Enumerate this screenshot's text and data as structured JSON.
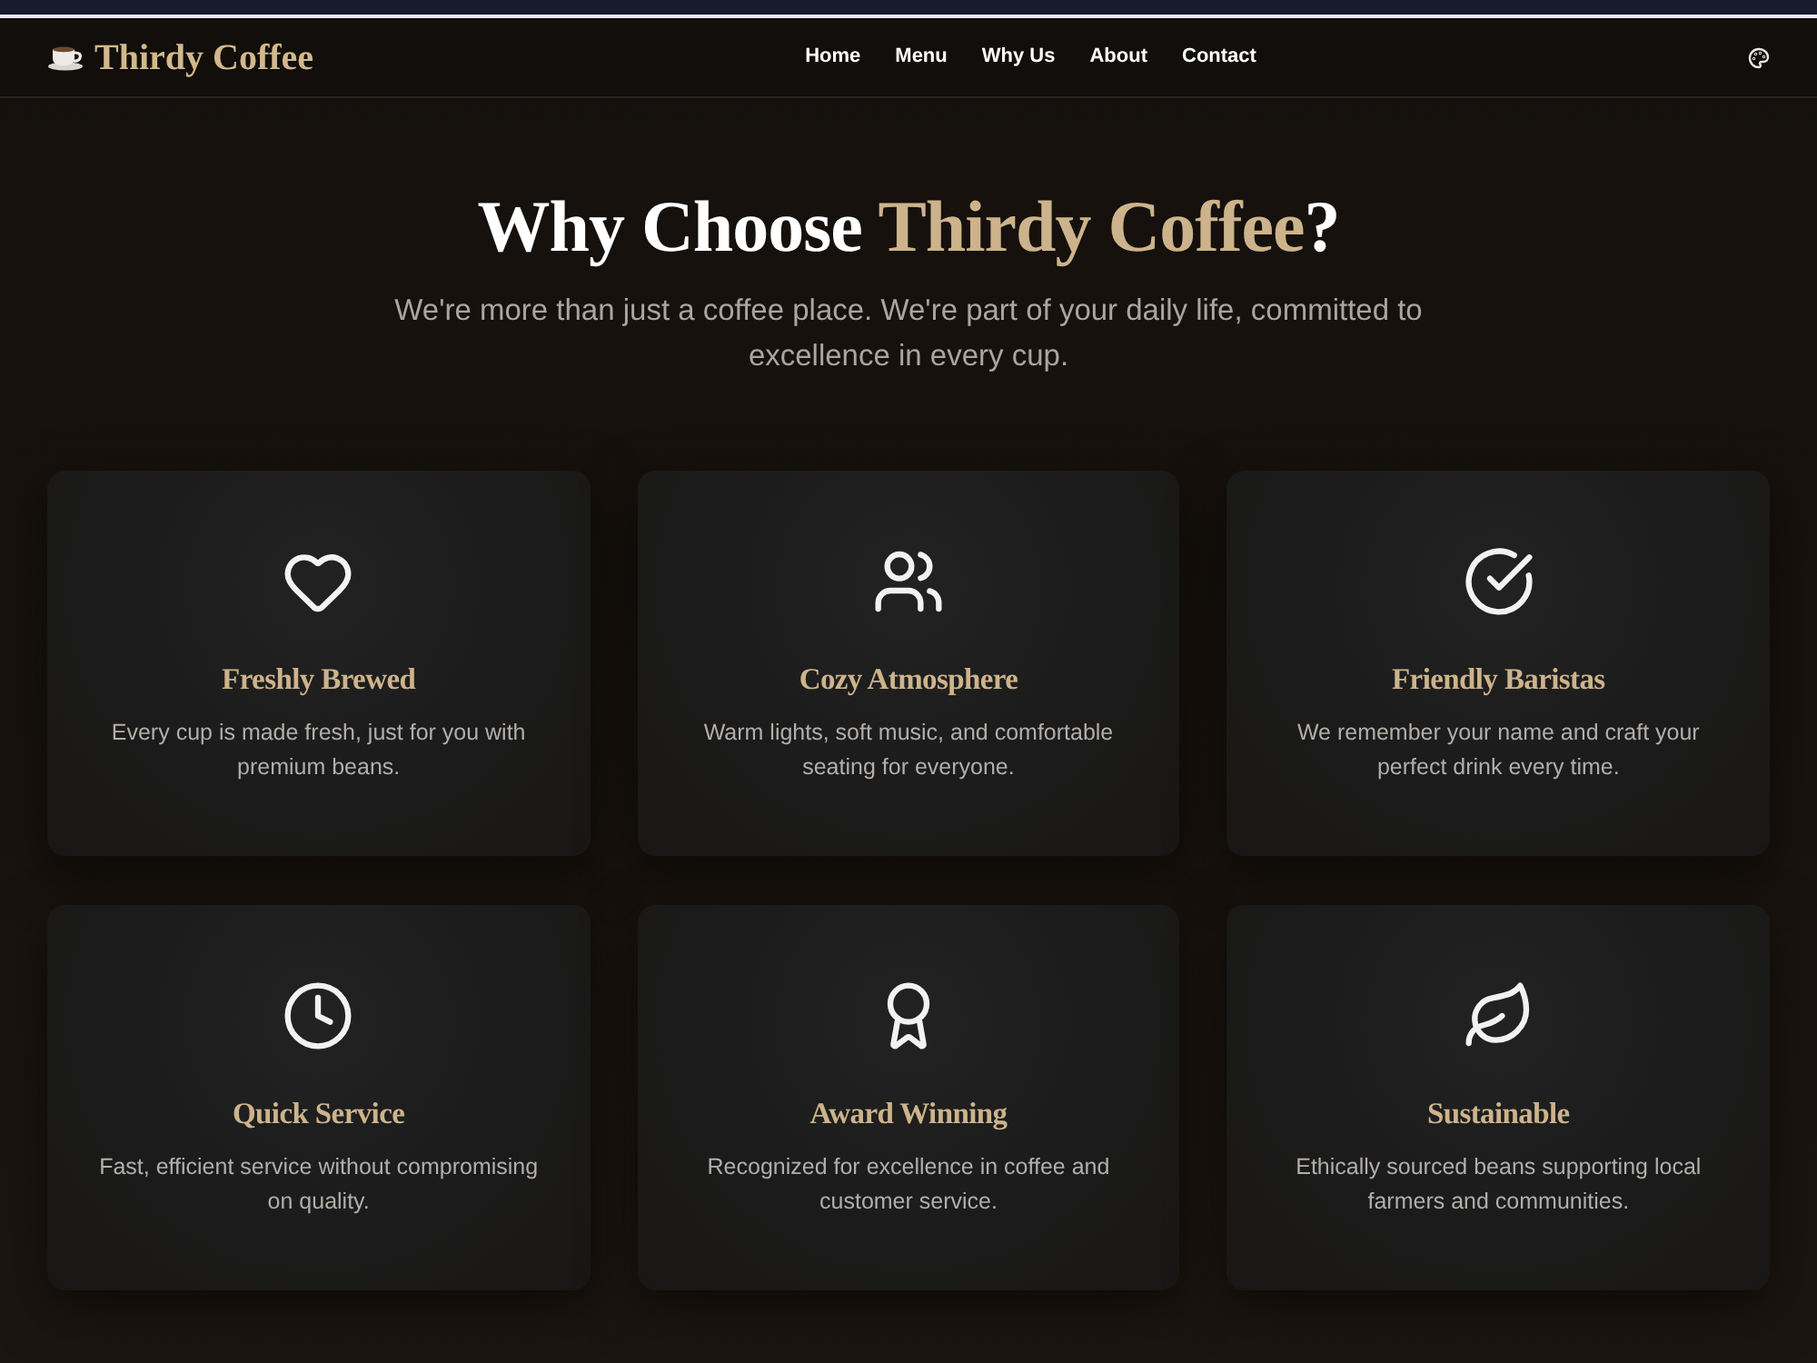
{
  "header": {
    "brand": "Thirdy Coffee",
    "nav": [
      "Home",
      "Menu",
      "Why Us",
      "About",
      "Contact"
    ]
  },
  "hero": {
    "title_start": "Why Choose ",
    "title_highlight": "Thirdy Coffee",
    "title_end": "?",
    "subtitle": "We're more than just a coffee place. We're part of your daily life, committed to excellence in every cup."
  },
  "features": [
    {
      "title": "Freshly Brewed",
      "description": "Every cup is made fresh, just for you with premium beans."
    },
    {
      "title": "Cozy Atmosphere",
      "description": "Warm lights, soft music, and comfortable seating for everyone."
    },
    {
      "title": "Friendly Baristas",
      "description": "We remember your name and craft your perfect drink every time."
    },
    {
      "title": "Quick Service",
      "description": "Fast, efficient service without compromising on quality."
    },
    {
      "title": "Award Winning",
      "description": "Recognized for excellence in coffee and customer service."
    },
    {
      "title": "Sustainable",
      "description": "Ethically sourced beans supporting local farmers and communities."
    }
  ]
}
